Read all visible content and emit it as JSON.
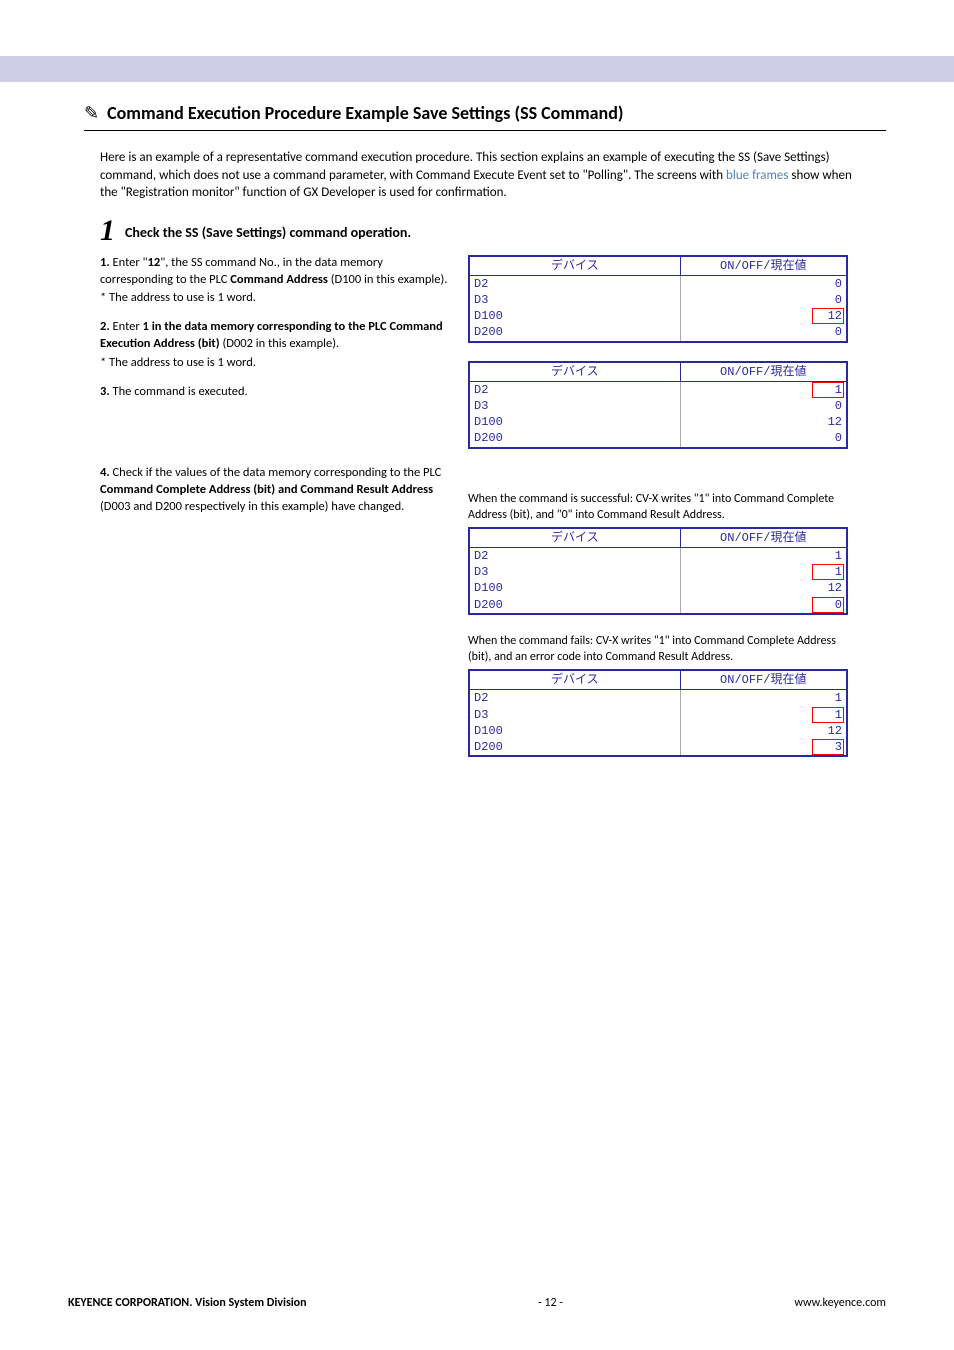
{
  "icon_pencil": "✎",
  "section_title": "Command Execution Procedure Example Save Settings (SS Command)",
  "intro": {
    "p1a": "Here is an example of a representative command execution procedure. This section explains an example of executing the SS (Save Settings) command, which does not use a command parameter, with Command Execute Event set to \"Polling\".  The screens with ",
    "p1b": "blue frames",
    "p1c": " show when the \"Registration monitor\" function of GX Developer is used for confirmation."
  },
  "step1": {
    "num": "1",
    "title": "Check the SS (Save Settings) command operation.",
    "s1a": "1.",
    "s1b": " Enter \"",
    "s1c": "12",
    "s1d": "\", the SS command No., in the data memory corresponding to the PLC ",
    "s1e": "Command Address",
    "s1f": " (D100 in this example).",
    "s1note": "* The address to use is 1 word.",
    "s2a": "2.",
    "s2b": " Enter ",
    "s2c": "1 in the data memory corresponding to the PLC Command Execution Address (bit)",
    "s2d": " (D002 in this example).",
    "s2note": "* The address to use is 1 word.",
    "s3a": "3.",
    "s3b": " The command is executed.",
    "s4a": "4.",
    "s4b": " Check if the values of the data memory corresponding to the PLC ",
    "s4c": "Command Complete Address (bit) and Command Result Address",
    "s4d": " (D003 and D200 respectively in this example) have changed."
  },
  "headers": {
    "h1": "デバイス",
    "h2": "ON/OFF/現在値"
  },
  "tbl1": [
    {
      "dev": "D2",
      "val": "0"
    },
    {
      "dev": "D3",
      "val": "0"
    },
    {
      "dev": "D100",
      "val": "12",
      "red": true
    },
    {
      "dev": "D200",
      "val": "0"
    }
  ],
  "tbl2": [
    {
      "dev": "D2",
      "val": "1",
      "red": true
    },
    {
      "dev": "D3",
      "val": "0"
    },
    {
      "dev": "D100",
      "val": "12"
    },
    {
      "dev": "D200",
      "val": "0"
    }
  ],
  "cap_success": "When the command is successful: CV-X writes \"1\" into Command Complete Address (bit), and \"0\" into Command Result Address.",
  "tbl3": [
    {
      "dev": "D2",
      "val": "1"
    },
    {
      "dev": "D3",
      "val": "1",
      "red": true
    },
    {
      "dev": "D100",
      "val": "12"
    },
    {
      "dev": "D200",
      "val": "0",
      "red": true
    }
  ],
  "cap_fail": "When the command fails: CV-X writes \"1\" into Command Complete Address (bit), and an error code into Command Result Address.",
  "tbl4": [
    {
      "dev": "D2",
      "val": "1"
    },
    {
      "dev": "D3",
      "val": "1",
      "red": true
    },
    {
      "dev": "D100",
      "val": "12"
    },
    {
      "dev": "D200",
      "val": "3",
      "red": true
    }
  ],
  "footer": {
    "left": "KEYENCE CORPORATION. Vision System Division",
    "center": "- 12 -",
    "right": "www.keyence.com"
  }
}
